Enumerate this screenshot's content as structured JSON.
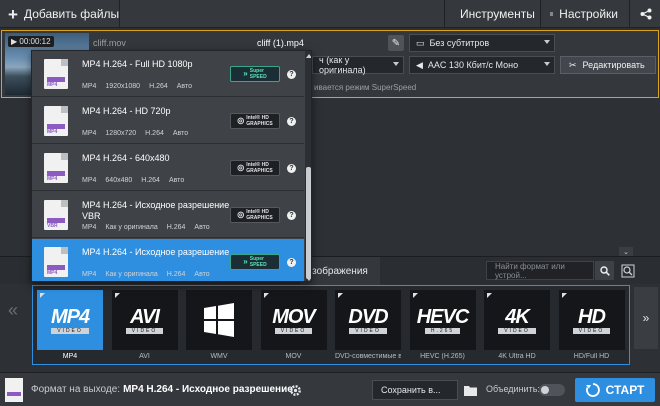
{
  "topbar": {
    "add_files_label": "Добавить файлы",
    "tools_label": "Инструменты",
    "settings_label": "Настройки",
    "icons": {
      "add": "plus-icon",
      "tools": "wand-icon",
      "settings": "hamburger-icon",
      "share": "share-icon"
    }
  },
  "file": {
    "timecode": "00:00:12",
    "source_name": "cliff.mov",
    "output_name": "cliff (1).mp4",
    "subtitles": "Без субтитров",
    "resolution": "ч (как у оригинала)",
    "audio": "AAC 130 Кбит/с Моно",
    "edit_label": "Редактировать",
    "superspeed_note": "ивается режим SuperSpeed"
  },
  "dropdown": {
    "items": [
      {
        "title": "MP4 H.264 - Full HD 1080p",
        "specs": [
          "MP4",
          "1920x1080",
          "H.264",
          "Авто"
        ],
        "badge": "superspeed"
      },
      {
        "title": "MP4 H.264 - HD 720p",
        "specs": [
          "MP4",
          "1280x720",
          "H.264",
          "Авто"
        ],
        "badge": "intel"
      },
      {
        "title": "MP4 H.264 - 640x480",
        "specs": [
          "MP4",
          "640x480",
          "H.264",
          "Авто"
        ],
        "badge": "intel"
      },
      {
        "title": "MP4 H.264 - Исходное разрешение VBR",
        "specs": [
          "MP4",
          "Как у оригинала",
          "H.264",
          "Авто"
        ],
        "badge": "intel"
      },
      {
        "title": "MP4 H.264 - Исходное разрешение",
        "specs": [
          "MP4",
          "Как у оригинала",
          "H.264",
          "Авто"
        ],
        "badge": "superspeed",
        "active": true
      }
    ],
    "badge_superspeed": {
      "line1": "Super",
      "line2": "SPEED"
    },
    "badge_intel": {
      "line1": "Intel® HD",
      "line2": "GRAPHICS"
    },
    "file_type": "MP4",
    "file_type_vbr": "VBR"
  },
  "categories": {
    "images_label": "зображения",
    "search_placeholder": "Найти формат или устрой..."
  },
  "formats": [
    {
      "big": "MP4",
      "small": "VIDEO",
      "label": "MP4",
      "active": true
    },
    {
      "big": "AVI",
      "small": "VIDEO",
      "label": "AVI"
    },
    {
      "big": "",
      "small": "",
      "label": "WMV",
      "icon": "windows-logo-icon"
    },
    {
      "big": "MOV",
      "small": "VIDEO",
      "label": "MOV"
    },
    {
      "big": "DVD",
      "small": "VIDEO",
      "label": "DVD-совместимые в..."
    },
    {
      "big": "HEVC",
      "small": "H.265",
      "label": "HEVC (H.265)"
    },
    {
      "big": "4K",
      "small": "VIDEO",
      "label": "4K Ultra HD"
    },
    {
      "big": "HD",
      "small": "VIDEO",
      "label": "HD/Full HD"
    }
  ],
  "bottombar": {
    "output_label": "Формат на выходе:",
    "output_value": "MP4 H.264 - Исходное разрешение",
    "save_label": "Сохранить в...",
    "merge_label": "Объединить:",
    "start_label": "СТАРТ"
  }
}
